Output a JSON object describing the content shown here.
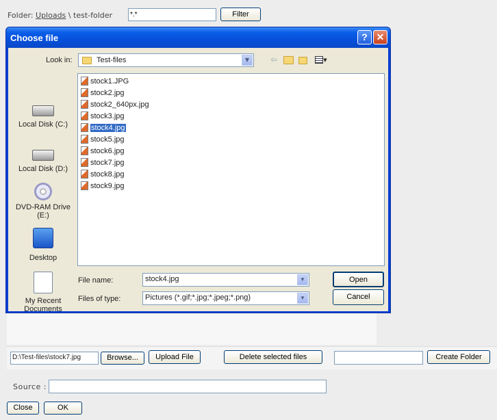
{
  "top": {
    "folder_label": "Folder:",
    "uploads_link": "Uploads",
    "separator": "\\",
    "current_folder": "test-folder",
    "filter_value": "*.*",
    "filter_button": "Filter"
  },
  "dialog": {
    "title": "Choose file",
    "help_glyph": "?",
    "close_glyph": "✕",
    "look_in_label": "Look in:",
    "look_in_value": "Test-files",
    "places": [
      {
        "label": "Local Disk (C:)"
      },
      {
        "label": "Local Disk (D:)"
      },
      {
        "label": "DVD-RAM Drive (E:)"
      },
      {
        "label": "Desktop"
      },
      {
        "label": "My Recent Documents"
      }
    ],
    "files": [
      "stock1.JPG",
      "stock2.jpg",
      "stock2_640px.jpg",
      "stock3.jpg",
      "stock4.jpg",
      "stock5.jpg",
      "stock6.jpg",
      "stock7.jpg",
      "stock8.jpg",
      "stock9.jpg"
    ],
    "selected_file": "stock4.jpg",
    "file_name_label": "File name:",
    "file_name_value": "stock4.jpg",
    "files_of_type_label": "Files of type:",
    "files_of_type_value": "Pictures (*.gif;*.jpg;*.jpeg;*.png)",
    "open_button": "Open",
    "cancel_button": "Cancel"
  },
  "upload": {
    "path_value": "D:\\Test-files\\stock7.jpg",
    "browse_button": "Browse...",
    "upload_button": "Upload File",
    "delete_button": "Delete selected files",
    "new_folder_value": "",
    "create_folder_button": "Create Folder"
  },
  "footer": {
    "source_label": "Source :",
    "source_value": "",
    "close_button": "Close",
    "ok_button": "OK"
  },
  "colors": {
    "title_bar": "#0a5ee8",
    "selection": "#316ac5",
    "dialog_bg": "#ece9d8"
  }
}
